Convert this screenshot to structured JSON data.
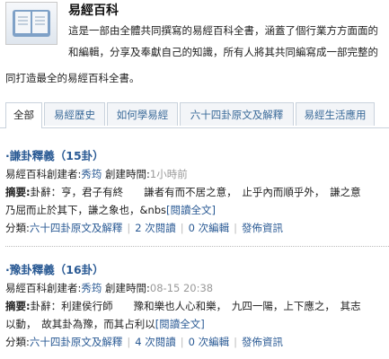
{
  "header": {
    "title": "易經百科",
    "desc_line1": "這是一部由全體共同撰寫的易經百科全書，涵蓋了個行業方方面面的",
    "desc_line2": "和編輯，分享及奉獻自己的知識，所有人將其共同編寫成一部完整的",
    "desc_line3": "同打造最全的易經百科全書。",
    "logo_icon": "book-icon"
  },
  "tabs": [
    {
      "label": "全部",
      "active": true
    },
    {
      "label": "易經歷史",
      "active": false
    },
    {
      "label": "如何學易經",
      "active": false
    },
    {
      "label": "六十四卦原文及解釋",
      "active": false
    },
    {
      "label": "易經生活應用",
      "active": false
    }
  ],
  "posts": [
    {
      "title": "·謙卦釋義（15卦）",
      "creator_prefix": "易經百科創建者:",
      "creator": "秀筠",
      "created_label": " 創建時間:",
      "created_time": "1小時前",
      "summary_label": "摘要:",
      "summary_line1": "卦辭：亨，君子有終　　謙者有而不居之意，　止乎內而順乎外，　謙之意",
      "summary_line2": "乃屈而止於其下，謙之象也，&nbs",
      "read_more": "[閱讀全文]",
      "category_label": "分類:",
      "category": "六十四卦原文及解釋",
      "edits": "2 次閱讀",
      "comments": "0 次編輯",
      "info": "發佈資訊"
    },
    {
      "title": "·豫卦釋義（16卦）",
      "creator_prefix": "易經百科創建者:",
      "creator": "秀筠",
      "created_label": " 創建時間:",
      "created_time": "08-15 20:38",
      "summary_label": "摘要:",
      "summary_line1": "卦辭：利建侯行師　　豫和樂也人心和樂，　九四一陽，上下應之，　其志",
      "summary_line2": "以動，　故其卦為豫，而其占利以",
      "read_more": "[閱讀全文]",
      "category_label": "分類:",
      "category": "六十四卦原文及解釋",
      "edits": "4 次閱讀",
      "comments": "0 次編輯",
      "info": "發佈資訊"
    }
  ]
}
